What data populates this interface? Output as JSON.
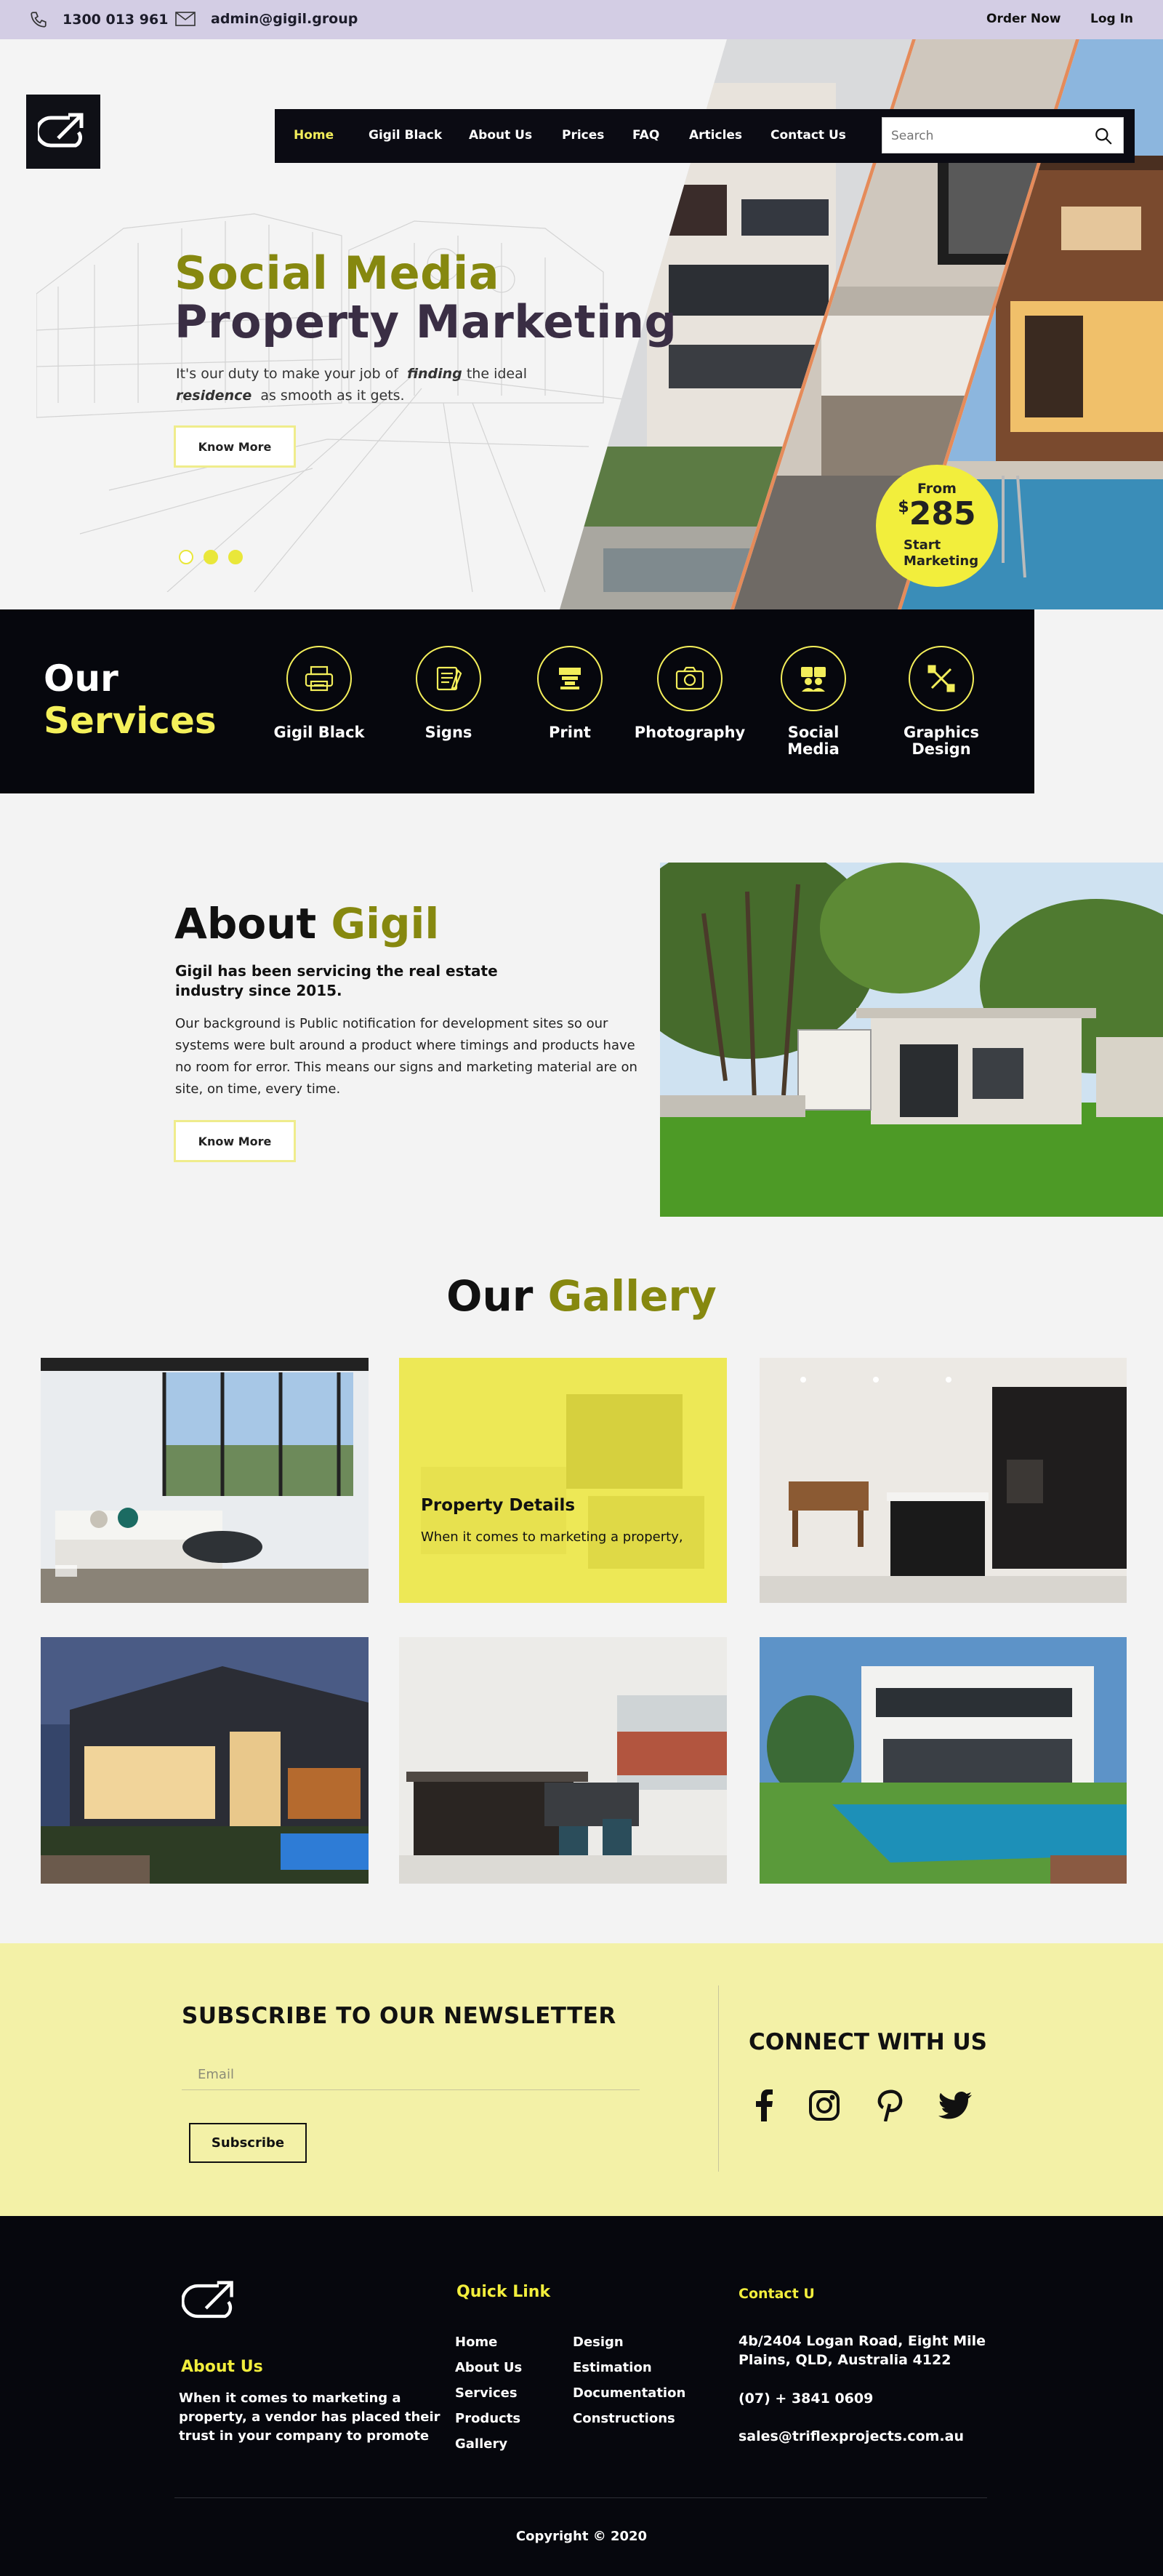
{
  "topbar": {
    "phone": "1300 013 961",
    "email": "admin@gigil.group",
    "order_now": "Order Now",
    "log_in": "Log In"
  },
  "nav": {
    "items": [
      "Home",
      "Gigil Black",
      "About Us",
      "Prices",
      "FAQ",
      "Articles",
      "Contact Us"
    ],
    "active": "Home",
    "search_placeholder": "Search"
  },
  "hero": {
    "title_line1": "Social Media",
    "title_line2": "Property Marketing",
    "subtitle_part1": "It's our duty to make your job of",
    "subtitle_em1": "finding",
    "subtitle_part2": "the ideal",
    "subtitle_em2": "residence",
    "subtitle_part3": "as smooth as it gets.",
    "button": "Know More",
    "slides": 3,
    "active_slide": 1,
    "badge": {
      "from": "From",
      "currency": "$",
      "amount": "285",
      "line1": "Start",
      "line2": "Marketing"
    }
  },
  "services": {
    "title_line1": "Our",
    "title_line2": "Services",
    "items": [
      {
        "label": "Gigil Black",
        "icon": "printer-icon"
      },
      {
        "label": "Signs",
        "icon": "sign-board-icon"
      },
      {
        "label": "Print",
        "icon": "print-press-icon"
      },
      {
        "label": "Photography",
        "icon": "camera-icon"
      },
      {
        "label": "Social Media",
        "icon": "people-icon"
      },
      {
        "label": "Graphics Design",
        "icon": "design-tools-icon"
      }
    ]
  },
  "about": {
    "title_a": "About",
    "title_b": "Gigil",
    "lead": "Gigil has been servicing the real estate industry since 2015.",
    "body": "Our background is Public notification for development sites so our systems were bult around a product where timings and products have no room for error. This means our signs and marketing material are on site, on time, every time.",
    "button": "Know More"
  },
  "gallery": {
    "title_a": "Our",
    "title_b": "Gallery",
    "overlay_title": "Property Details",
    "overlay_text": "When it comes to marketing a property,"
  },
  "newsletter": {
    "title": "SUBSCRIBE TO OUR NEWSLETTER",
    "email_placeholder": "Email",
    "button": "Subscribe",
    "connect_title": "CONNECT WITH US",
    "social": [
      "facebook-icon",
      "instagram-icon",
      "pinterest-icon",
      "twitter-icon"
    ]
  },
  "footer": {
    "about_title": "About Us",
    "about_text": "When it comes to marketing a property, a vendor has placed their trust in your company to promote",
    "quick_link_title": "Quick Link",
    "links_col1": [
      "Home",
      "About Us",
      "Services",
      "Products",
      "Gallery"
    ],
    "links_col2": [
      "Design",
      "Estimation",
      "Documentation",
      "Constructions"
    ],
    "contact_title": "Contact U",
    "address": "4b/2404 Logan Road, Eight Mile Plains, QLD, Australia 4122",
    "phone": "(07) + 3841 0609",
    "email": "sales@triflexprojects.com.au",
    "copyright": "Copyright © 2020"
  },
  "colors": {
    "accent_yellow": "#f2ee3c",
    "olive": "#86880f",
    "dark": "#06070d",
    "topbar": "#d3cde4",
    "newsletter_bg": "#f3f1a7"
  }
}
